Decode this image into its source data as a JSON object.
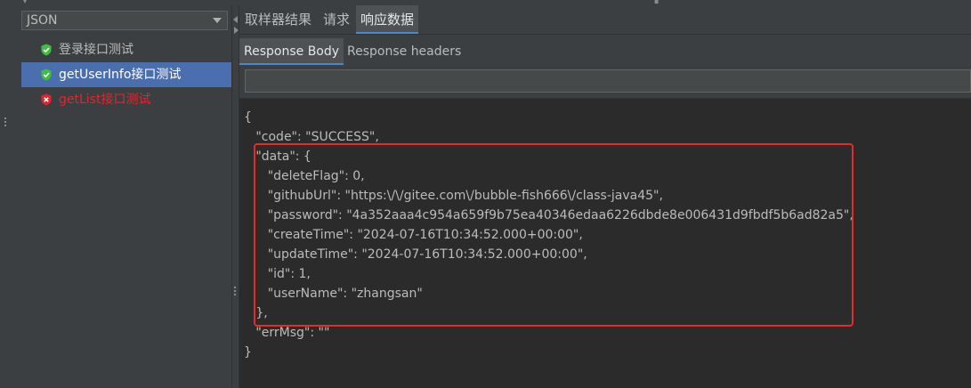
{
  "colors": {
    "background": "#3c3f41",
    "code_background": "#2b2b2b",
    "selection": "#4b6eaf",
    "fail_text": "#e0262d",
    "pass_icon": "#3fbf3f",
    "fail_icon": "#e0262d",
    "highlight_border": "#e62a2a"
  },
  "left_panel": {
    "renderer_select": {
      "value": "JSON"
    },
    "tree_items": [
      {
        "label": "登录接口测试",
        "status": "pass",
        "icon": "check-shield-icon"
      },
      {
        "label": "getUserInfo接口测试",
        "status": "pass",
        "icon": "check-shield-icon",
        "selected": true
      },
      {
        "label": "getList接口测试",
        "status": "fail",
        "icon": "error-shield-icon"
      }
    ]
  },
  "right_panel": {
    "tabs": [
      {
        "label": "取样器结果"
      },
      {
        "label": "请求"
      },
      {
        "label": "响应数据",
        "active": true
      }
    ],
    "sub_tabs": [
      {
        "label": "Response Body",
        "active": true
      },
      {
        "label": "Response headers"
      }
    ],
    "search_value": "",
    "response_lines": [
      "{",
      "   \"code\": \"SUCCESS\",",
      "   \"data\": {",
      "      \"deleteFlag\": 0,",
      "      \"githubUrl\": \"https:\\/\\/gitee.com\\/bubble-fish666\\/class-java45\",",
      "      \"password\": \"4a352aaa4c954a659f9b75ea40346edaa6226dbde8e006431d9fbdf5b6ad82a5\",",
      "      \"createTime\": \"2024-07-16T10:34:52.000+00:00\",",
      "      \"updateTime\": \"2024-07-16T10:34:52.000+00:00\",",
      "      \"id\": 1,",
      "      \"userName\": \"zhangsan\"",
      "   },",
      "   \"errMsg\": \"\"",
      "}"
    ]
  }
}
